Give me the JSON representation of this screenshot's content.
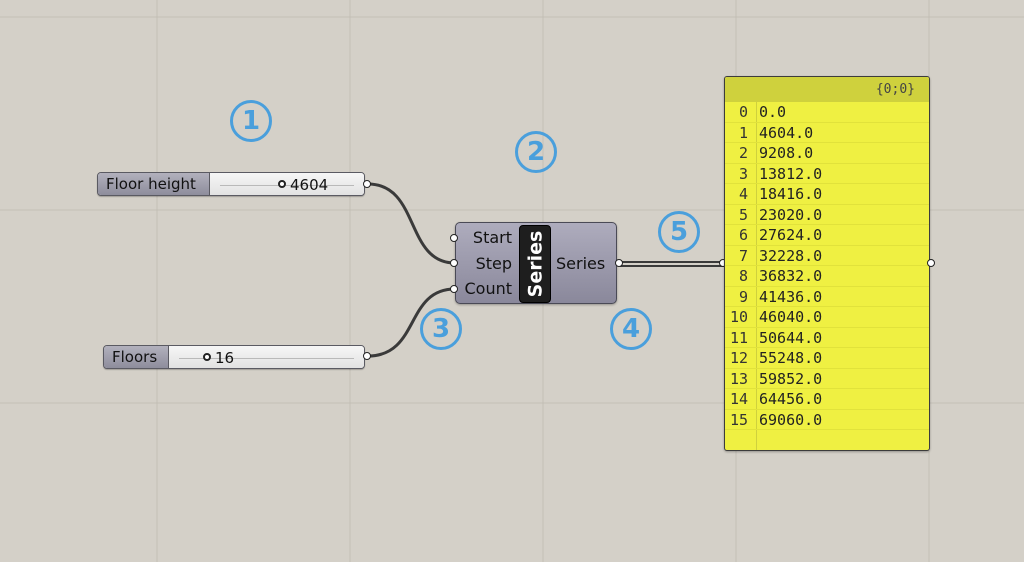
{
  "colors": {
    "canvas_bg": "#d4d0c8",
    "badge_blue": "#4a9fdc",
    "component_body": "#9d9bad",
    "panel_yellow": "#eff042",
    "panel_header": "#cfd13d"
  },
  "badges": [
    "1",
    "2",
    "3",
    "4",
    "5"
  ],
  "floor_height_slider": {
    "label": "Floor height",
    "value": "4604"
  },
  "floors_slider": {
    "label": "Floors",
    "value": "16"
  },
  "series_component": {
    "title": "Series",
    "inputs": [
      "Start",
      "Step",
      "Count"
    ],
    "output": "Series"
  },
  "panel": {
    "path": "{0;0}",
    "rows": [
      {
        "index": "0",
        "value": "0.0"
      },
      {
        "index": "1",
        "value": "4604.0"
      },
      {
        "index": "2",
        "value": "9208.0"
      },
      {
        "index": "3",
        "value": "13812.0"
      },
      {
        "index": "4",
        "value": "18416.0"
      },
      {
        "index": "5",
        "value": "23020.0"
      },
      {
        "index": "6",
        "value": "27624.0"
      },
      {
        "index": "7",
        "value": "32228.0"
      },
      {
        "index": "8",
        "value": "36832.0"
      },
      {
        "index": "9",
        "value": "41436.0"
      },
      {
        "index": "10",
        "value": "46040.0"
      },
      {
        "index": "11",
        "value": "50644.0"
      },
      {
        "index": "12",
        "value": "55248.0"
      },
      {
        "index": "13",
        "value": "59852.0"
      },
      {
        "index": "14",
        "value": "64456.0"
      },
      {
        "index": "15",
        "value": "69060.0"
      }
    ]
  }
}
